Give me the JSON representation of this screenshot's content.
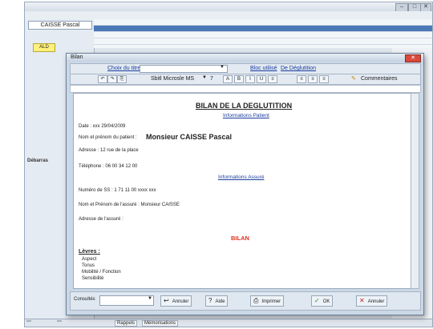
{
  "app": {
    "title": "",
    "menus": [
      "",
      ""
    ]
  },
  "left_panel": {
    "patient_name": "CAISSE Pascal",
    "lines": [
      "",
      "",
      "",
      "",
      "",
      "",
      "",
      "",
      "",
      "",
      "",
      "",
      "",
      ""
    ],
    "note": "ALD",
    "section": "Débarras"
  },
  "right_panel": {
    "lines": [
      "",
      "",
      "",
      "",
      "",
      "",
      "",
      "",
      "",
      ""
    ]
  },
  "taskbar": {
    "items": [
      "",
      "",
      "Rappels",
      "Mémorisations"
    ]
  },
  "dialog": {
    "title": "Bilan",
    "close": "✕",
    "toolbar1": {
      "choix_label": "Choix du titre",
      "bloc_label": "Bloc utilisé",
      "bloc_value": "De Déglutition"
    },
    "toolbar2": {
      "font_label": "Sbitl Microsle MS",
      "size": "7",
      "comment_label": "Commentaires"
    },
    "document": {
      "title": "BILAN DE LA DEGLUTITION",
      "info_patient_header": "Informations Patient",
      "date_line": "Date : xxx  29/04/2009",
      "nom_line_prefix": "Nom et prénom du patient :",
      "nom_line_value": "Monsieur CAISSE Pascal",
      "adresse_line": "Adresse :  12 rue de la place",
      "telephone_line": "Téléphone : 06 00 34 12 00",
      "info_assure_header": "Informations Assuré",
      "numero_line": "Numéro de SS : 1 71 11 00 xxxx xxx",
      "nom_assure_line": "Nom et Prénom de l'assuré : Monsieur CAISSE",
      "adresse_assure_line": "Adresse de l'assuré :",
      "bilan_header": "BILAN",
      "levres_header": "Lèvres :",
      "levres_items": [
        "Aspect",
        "Tonus",
        "Mobilité / Fonction",
        "Sensibilité"
      ]
    },
    "bottom": {
      "field_label": "Consultés",
      "buttons": [
        "Annuler",
        "Aide",
        "Imprimer",
        "OK",
        "Annuler"
      ]
    }
  },
  "colors": {
    "accent": "#1c3d9c",
    "title_red": "#e0331f",
    "selection": "#4a79b8",
    "note_yellow": "#fff07a"
  }
}
